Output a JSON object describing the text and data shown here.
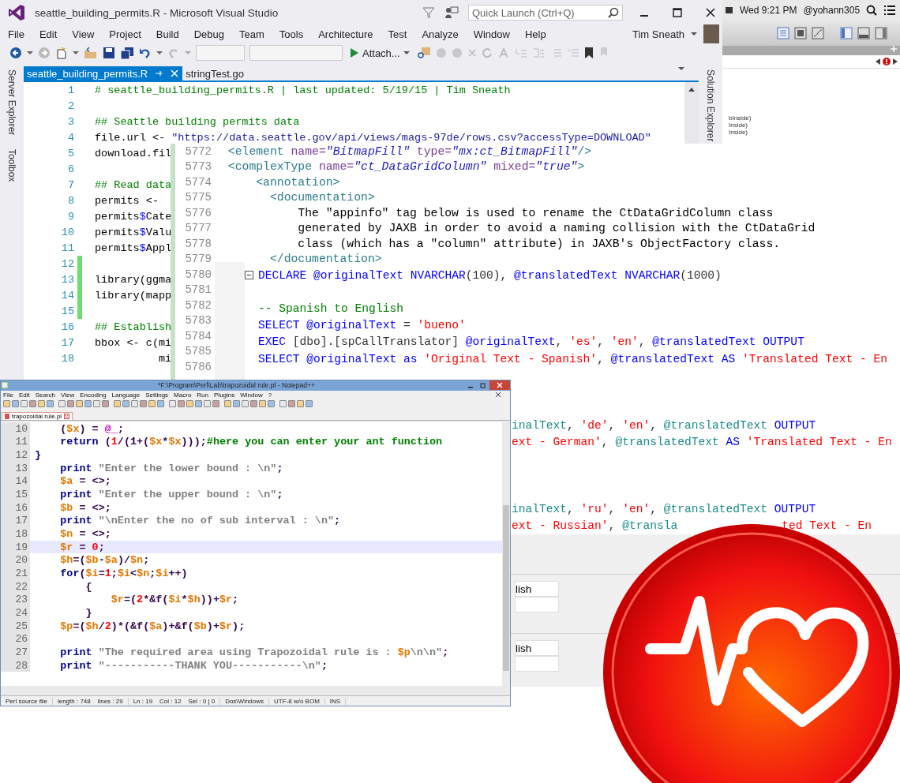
{
  "vs": {
    "title": "seattle_building_permits.R - Microsoft Visual Studio",
    "quick_launch": {
      "placeholder": "Quick Launch (Ctrl+Q)"
    },
    "menu": [
      "File",
      "Edit",
      "View",
      "Project",
      "Build",
      "Debug",
      "Team",
      "Tools",
      "Architecture",
      "Test",
      "Analyze",
      "Window",
      "Help"
    ],
    "user": "Tim Sneath",
    "attach": "Attach...",
    "side_tabs": [
      "Server Explorer",
      "Toolbox"
    ],
    "right_tabs": [
      "Solution Explorer"
    ],
    "tabs": [
      {
        "label": "seattle_building_permits.R",
        "selected": true
      },
      {
        "label": "stringTest.go",
        "selected": false
      }
    ],
    "lines": [
      {
        "n": "1",
        "changed": false,
        "parts": [
          {
            "text": "# seattle_building_permits.R | last updated: 5/19/15 | Tim Sneath",
            "kind": "comment"
          }
        ]
      },
      {
        "n": "2",
        "changed": false
      },
      {
        "n": "3",
        "changed": false,
        "parts": [
          {
            "text": "## Seattle building permits data",
            "kind": "comment"
          }
        ]
      },
      {
        "n": "4",
        "changed": false,
        "parts": [
          {
            "text": "file.url <- ",
            "kind": "code"
          },
          {
            "text": "\"https://data.seattle.gov/api/views/mags-97de/rows.csv?accessType=DOWNLOAD\"",
            "kind": "string"
          }
        ]
      },
      {
        "n": "5",
        "changed": false,
        "parts": [
          {
            "text": "download.fil",
            "kind": "code"
          }
        ]
      },
      {
        "n": "6",
        "changed": false
      },
      {
        "n": "7",
        "changed": false,
        "parts": [
          {
            "text": "## Read data",
            "kind": "comment"
          }
        ]
      },
      {
        "n": "8",
        "changed": false,
        "parts": [
          {
            "text": "permits <-",
            "kind": "code"
          }
        ]
      },
      {
        "n": "9",
        "changed": false,
        "parts": [
          {
            "text": "permits",
            "kind": "code"
          },
          {
            "text": "$",
            "kind": "op"
          },
          {
            "text": "Cate",
            "kind": "code"
          }
        ]
      },
      {
        "n": "10",
        "changed": false,
        "parts": [
          {
            "text": "permits",
            "kind": "code"
          },
          {
            "text": "$",
            "kind": "op"
          },
          {
            "text": "Valu",
            "kind": "code"
          }
        ]
      },
      {
        "n": "11",
        "changed": false,
        "parts": [
          {
            "text": "permits",
            "kind": "code"
          },
          {
            "text": "$",
            "kind": "op"
          },
          {
            "text": "Appl",
            "kind": "code"
          }
        ]
      },
      {
        "n": "12",
        "changed": true
      },
      {
        "n": "13",
        "changed": true,
        "parts": [
          {
            "text": "library(ggma",
            "kind": "code"
          }
        ]
      },
      {
        "n": "14",
        "changed": true,
        "parts": [
          {
            "text": "library(mapp",
            "kind": "code"
          }
        ]
      },
      {
        "n": "15",
        "changed": true
      },
      {
        "n": "16",
        "changed": false,
        "parts": [
          {
            "text": "## Establish",
            "kind": "comment"
          }
        ]
      },
      {
        "n": "17",
        "changed": false,
        "parts": [
          {
            "text": "bbox <- c(mi",
            "kind": "code"
          }
        ]
      },
      {
        "n": "18",
        "changed": false,
        "parts": [
          {
            "text": "          mi",
            "kind": "code"
          }
        ]
      }
    ]
  },
  "mac": {
    "clock": "Wed 9:21 PM",
    "user": "@yohann305",
    "fragments": [
      "bInside)",
      "Inside)",
      "Inside)"
    ]
  },
  "xml": {
    "lines": [
      {
        "n": "5772",
        "parts": [
          {
            "text": " <element ",
            "kind": "tag"
          },
          {
            "text": "name=",
            "kind": "attr"
          },
          {
            "text": "\"BitmapFill\"",
            "kind": "value"
          },
          {
            "text": " type=",
            "kind": "attr"
          },
          {
            "text": "\"mx:ct_BitmapFill\"",
            "kind": "value"
          },
          {
            "text": "/>",
            "kind": "tag"
          }
        ]
      },
      {
        "n": "5773",
        "parts": [
          {
            "text": " <complexType ",
            "kind": "tag"
          },
          {
            "text": "name=",
            "kind": "attr"
          },
          {
            "text": "\"ct_DataGridColumn\"",
            "kind": "value"
          },
          {
            "text": " mixed=",
            "kind": "attr"
          },
          {
            "text": "\"true\"",
            "kind": "value"
          },
          {
            "text": ">",
            "kind": "tag"
          }
        ]
      },
      {
        "n": "5774",
        "parts": [
          {
            "text": "     <annotation>",
            "kind": "tag"
          }
        ]
      },
      {
        "n": "5775",
        "parts": [
          {
            "text": "       <documentation>",
            "kind": "tag"
          }
        ]
      },
      {
        "n": "5776",
        "parts": [
          {
            "text": "           The \"appinfo\" tag below is used to rename the CtDataGridColumn class",
            "kind": "code"
          }
        ]
      },
      {
        "n": "5777",
        "parts": [
          {
            "text": "           generated by JAXB in order to avoid a naming collision with the CtDataGrid",
            "kind": "code"
          }
        ]
      },
      {
        "n": "5778",
        "parts": [
          {
            "text": "           class (which has a \"column\" attribute) in JAXB's ObjectFactory class.",
            "kind": "code"
          }
        ]
      },
      {
        "n": "5779",
        "parts": [
          {
            "text": "       </documentation>",
            "kind": "tag"
          }
        ]
      },
      {
        "n": "5780"
      },
      {
        "n": "5781"
      },
      {
        "n": "5782"
      },
      {
        "n": "5783"
      },
      {
        "n": "5784"
      },
      {
        "n": "5785"
      },
      {
        "n": "5786"
      }
    ]
  },
  "sql": {
    "lines": [
      {
        "kind": "full",
        "parts": [
          {
            "text": "DECLARE @originalText NVARCHAR",
            "kind": "keyword"
          },
          {
            "text": "(100), ",
            "kind": "code"
          },
          {
            "text": "@translatedText NVARCHAR",
            "kind": "keyword"
          },
          {
            "text": "(1000)",
            "kind": "code"
          }
        ]
      },
      {
        "kind": "blank"
      },
      {
        "kind": "full",
        "parts": [
          {
            "text": "-- Spanish to English",
            "kind": "comment"
          }
        ]
      },
      {
        "kind": "full",
        "parts": [
          {
            "text": "SELECT @originalText ",
            "kind": "keyword"
          },
          {
            "text": "= ",
            "kind": "code"
          },
          {
            "text": "'bueno'",
            "kind": "string"
          }
        ]
      },
      {
        "kind": "full",
        "parts": [
          {
            "text": "EXEC ",
            "kind": "keyword"
          },
          {
            "text": "[dbo].[spCallTranslator] ",
            "kind": "code"
          },
          {
            "text": "@originalText",
            "kind": "keyword"
          },
          {
            "text": ", ",
            "kind": "code"
          },
          {
            "text": "'es'",
            "kind": "string"
          },
          {
            "text": ", ",
            "kind": "code"
          },
          {
            "text": "'en'",
            "kind": "string"
          },
          {
            "text": ", ",
            "kind": "code"
          },
          {
            "text": "@translatedText OUTPUT",
            "kind": "keyword"
          }
        ]
      },
      {
        "kind": "full",
        "parts": [
          {
            "text": "SELECT @originalText as ",
            "kind": "keyword"
          },
          {
            "text": "'Original Text - Spanish'",
            "kind": "string"
          },
          {
            "text": ", ",
            "kind": "code"
          },
          {
            "text": "@translatedText AS ",
            "kind": "keyword"
          },
          {
            "text": "'Translated Text - En",
            "kind": "string"
          }
        ]
      },
      {
        "kind": "blank"
      },
      {
        "kind": "blank"
      },
      {
        "kind": "blank"
      },
      {
        "kind": "tail",
        "parts": [
          {
            "text": "inalText",
            "kind": "var"
          },
          {
            "text": ", ",
            "kind": "code"
          },
          {
            "text": "'de'",
            "kind": "string"
          },
          {
            "text": ", ",
            "kind": "code"
          },
          {
            "text": "'en'",
            "kind": "string"
          },
          {
            "text": ", ",
            "kind": "code"
          },
          {
            "text": "@translatedText ",
            "kind": "var"
          },
          {
            "text": "OUTPUT",
            "kind": "keyword"
          }
        ]
      },
      {
        "kind": "tail",
        "parts": [
          {
            "text": "ext - German'",
            "kind": "string"
          },
          {
            "text": ", ",
            "kind": "code"
          },
          {
            "text": "@translatedText ",
            "kind": "var"
          },
          {
            "text": "AS ",
            "kind": "keyword"
          },
          {
            "text": "'Translated Text - En",
            "kind": "string"
          }
        ]
      },
      {
        "kind": "blank"
      },
      {
        "kind": "blank"
      },
      {
        "kind": "blank"
      },
      {
        "kind": "tail",
        "parts": [
          {
            "text": "inalText",
            "kind": "var"
          },
          {
            "text": ", ",
            "kind": "code"
          },
          {
            "text": "'ru'",
            "kind": "string"
          },
          {
            "text": ", ",
            "kind": "code"
          },
          {
            "text": "'en'",
            "kind": "string"
          },
          {
            "text": ", ",
            "kind": "code"
          },
          {
            "text": "@translatedText ",
            "kind": "var"
          },
          {
            "text": "OUTPUT",
            "kind": "keyword"
          }
        ]
      },
      {
        "kind": "split",
        "parts": [
          {
            "text": "ext - Russian'",
            "kind": "string"
          },
          {
            "text": ", ",
            "kind": "code"
          },
          {
            "text": "@transla",
            "kind": "var"
          }
        ],
        "after": [
          {
            "text": "ted Text - En",
            "kind": "string"
          }
        ]
      }
    ],
    "results": [
      "lish",
      "lish"
    ]
  },
  "notepad": {
    "title": "*F:\\Program\\Perl\\Lab\\trapozoidal rule.pl - Notepad++",
    "menu": [
      "File",
      "Edit",
      "Search",
      "View",
      "Encoding",
      "Language",
      "Settings",
      "Macro",
      "Run",
      "Plugins",
      "Window",
      "?"
    ],
    "tabs": [
      {
        "label": "trapozoidal rule.pl",
        "selected": true
      }
    ],
    "lines": [
      {
        "n": "10",
        "current": false,
        "parts": [
          {
            "text": "    (",
            "kind": "code"
          },
          {
            "text": "$x",
            "kind": "var"
          },
          {
            "text": ") = ",
            "kind": "code"
          },
          {
            "text": "@_",
            "kind": "special"
          },
          {
            "text": ";",
            "kind": "code"
          }
        ]
      },
      {
        "n": "11",
        "current": false,
        "parts": [
          {
            "text": "    return",
            "kind": "keyword"
          },
          {
            "text": " (",
            "kind": "code"
          },
          {
            "text": "1",
            "kind": "number"
          },
          {
            "text": "/(1+(",
            "kind": "code"
          },
          {
            "text": "$x",
            "kind": "var"
          },
          {
            "text": "*",
            "kind": "code"
          },
          {
            "text": "$x",
            "kind": "var"
          },
          {
            "text": ")));",
            "kind": "code"
          },
          {
            "text": "#here you can enter your ant function",
            "kind": "comment"
          }
        ]
      },
      {
        "n": "12",
        "current": false,
        "parts": [
          {
            "text": "}",
            "kind": "keyword"
          }
        ]
      },
      {
        "n": "13",
        "current": false,
        "parts": [
          {
            "text": "    print",
            "kind": "keyword"
          },
          {
            "text": " \"Enter the lower bound : \\n\"",
            "kind": "string"
          },
          {
            "text": ";",
            "kind": "code"
          }
        ]
      },
      {
        "n": "14",
        "current": false,
        "parts": [
          {
            "text": "    $a",
            "kind": "var"
          },
          {
            "text": " = <>;",
            "kind": "code"
          }
        ]
      },
      {
        "n": "15",
        "current": false,
        "parts": [
          {
            "text": "    print",
            "kind": "keyword"
          },
          {
            "text": " \"Enter the upper bound : \\n\"",
            "kind": "string"
          },
          {
            "text": ";",
            "kind": "code"
          }
        ]
      },
      {
        "n": "16",
        "current": false,
        "parts": [
          {
            "text": "    $b",
            "kind": "var"
          },
          {
            "text": " = <>;",
            "kind": "code"
          }
        ]
      },
      {
        "n": "17",
        "current": false,
        "parts": [
          {
            "text": "    print",
            "kind": "keyword"
          },
          {
            "text": " \"\\nEnter the no of sub interval : \\n\"",
            "kind": "string"
          },
          {
            "text": ";",
            "kind": "code"
          }
        ]
      },
      {
        "n": "18",
        "current": false,
        "parts": [
          {
            "text": "    $n",
            "kind": "var"
          },
          {
            "text": " = <>;",
            "kind": "code"
          }
        ]
      },
      {
        "n": "19",
        "current": true,
        "parts": [
          {
            "text": "    $r",
            "kind": "var"
          },
          {
            "text": " = ",
            "kind": "code"
          },
          {
            "text": "0",
            "kind": "number"
          },
          {
            "text": ";",
            "kind": "code"
          }
        ]
      },
      {
        "n": "20",
        "current": false,
        "parts": [
          {
            "text": "    $h",
            "kind": "var"
          },
          {
            "text": "=(",
            "kind": "code"
          },
          {
            "text": "$b",
            "kind": "var"
          },
          {
            "text": "-",
            "kind": "code"
          },
          {
            "text": "$a",
            "kind": "var"
          },
          {
            "text": ")/",
            "kind": "code"
          },
          {
            "text": "$n",
            "kind": "var"
          },
          {
            "text": ";",
            "kind": "code"
          }
        ]
      },
      {
        "n": "21",
        "current": false,
        "parts": [
          {
            "text": "    for",
            "kind": "keyword"
          },
          {
            "text": "(",
            "kind": "code"
          },
          {
            "text": "$i",
            "kind": "var"
          },
          {
            "text": "=",
            "kind": "code"
          },
          {
            "text": "1",
            "kind": "number"
          },
          {
            "text": ";",
            "kind": "code"
          },
          {
            "text": "$i",
            "kind": "var"
          },
          {
            "text": "<",
            "kind": "code"
          },
          {
            "text": "$n",
            "kind": "var"
          },
          {
            "text": ";",
            "kind": "code"
          },
          {
            "text": "$i",
            "kind": "var"
          },
          {
            "text": "++)",
            "kind": "code"
          }
        ]
      },
      {
        "n": "22",
        "current": false,
        "parts": [
          {
            "text": "        {",
            "kind": "code"
          }
        ]
      },
      {
        "n": "23",
        "current": false,
        "parts": [
          {
            "text": "            $r",
            "kind": "var"
          },
          {
            "text": "=(",
            "kind": "code"
          },
          {
            "text": "2",
            "kind": "number"
          },
          {
            "text": "*&f(",
            "kind": "code"
          },
          {
            "text": "$i",
            "kind": "var"
          },
          {
            "text": "*",
            "kind": "code"
          },
          {
            "text": "$h",
            "kind": "var"
          },
          {
            "text": "))+",
            "kind": "code"
          },
          {
            "text": "$r",
            "kind": "var"
          },
          {
            "text": ";",
            "kind": "code"
          }
        ]
      },
      {
        "n": "24",
        "current": false,
        "parts": [
          {
            "text": "        }",
            "kind": "code"
          }
        ]
      },
      {
        "n": "25",
        "current": false,
        "parts": [
          {
            "text": "    $p",
            "kind": "var"
          },
          {
            "text": "=(",
            "kind": "code"
          },
          {
            "text": "$h",
            "kind": "var"
          },
          {
            "text": "/",
            "kind": "code"
          },
          {
            "text": "2",
            "kind": "number"
          },
          {
            "text": ")*(&f(",
            "kind": "code"
          },
          {
            "text": "$a",
            "kind": "var"
          },
          {
            "text": ")+&f(",
            "kind": "code"
          },
          {
            "text": "$b",
            "kind": "var"
          },
          {
            "text": ")+",
            "kind": "code"
          },
          {
            "text": "$r",
            "kind": "var"
          },
          {
            "text": ");",
            "kind": "code"
          }
        ]
      },
      {
        "n": "26",
        "current": false
      },
      {
        "n": "27",
        "current": false,
        "parts": [
          {
            "text": "    print",
            "kind": "keyword"
          },
          {
            "text": " \"The required area using Trapozoidal rule is : ",
            "kind": "string"
          },
          {
            "text": "$p",
            "kind": "var"
          },
          {
            "text": "\\n\\n\"",
            "kind": "string"
          },
          {
            "text": ";",
            "kind": "code"
          }
        ]
      },
      {
        "n": "28",
        "current": false,
        "parts": [
          {
            "text": "    print",
            "kind": "keyword"
          },
          {
            "text": " \"-----------THANK YOU-----------\\n\"",
            "kind": "string"
          },
          {
            "text": ";",
            "kind": "code"
          }
        ]
      }
    ],
    "status": [
      "Perl source file",
      "length : 748    lines : 29",
      "Ln : 19    Col : 12    Sel : 0 | 0",
      "Dos\\Windows",
      "UTF-8 w/o BOM",
      "INS"
    ]
  }
}
